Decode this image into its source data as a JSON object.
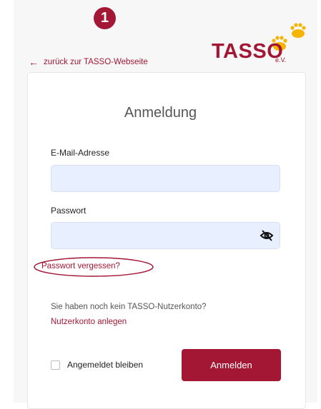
{
  "step_badge": "1",
  "nav": {
    "back_arrow": "←",
    "back_label": "zurück zur TASSO-Webseite"
  },
  "logo": {
    "text": "TASSO",
    "suffix": "e.V.",
    "icon": "paw-prints-icon"
  },
  "form": {
    "title": "Anmeldung",
    "email_label": "E-Mail-Adresse",
    "email_value": "",
    "password_label": "Passwort",
    "password_value": "",
    "password_toggle_icon": "eye-slash-icon",
    "forgot_password": "Passwort vergessen?",
    "no_account_text": "Sie haben noch kein TASSO-Nutzerkonto?",
    "create_account": "Nutzerkonto anlegen",
    "remember_me": "Angemeldet bleiben",
    "remember_checked": false,
    "submit": "Anmelden"
  },
  "colors": {
    "accent": "#a41734",
    "paw": "#f4b400",
    "input_bg": "#e8efff",
    "page_bg": "#f7f7f7"
  }
}
